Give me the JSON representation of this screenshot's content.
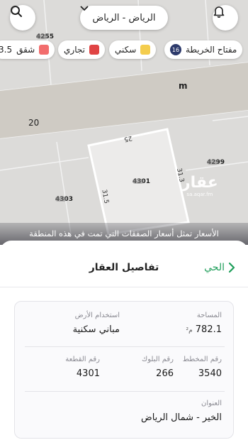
{
  "header": {
    "city": "الرياض - الرياض"
  },
  "legend": {
    "key_label": "مفتاح الخريطة",
    "key_count": "16",
    "items": [
      {
        "label": "سكني",
        "color": "#f4cd4e"
      },
      {
        "label": "تجاري",
        "color": "#e04444"
      },
      {
        "label": "شقق",
        "color": "#f26d6d",
        "count": "3.5"
      }
    ]
  },
  "map": {
    "parcels": {
      "p4255": "4255",
      "p4299": "4299",
      "p4301": "4301",
      "p4303": "4303"
    },
    "dims": {
      "top": "25",
      "right": "31.3",
      "left": "31.5"
    },
    "roads": {
      "width": "20",
      "m": "m"
    },
    "watermark": {
      "name": "عقار",
      "domain": "sa.aqar.fm"
    },
    "note": "الأسعار تمثل أسعار الصفقات التي تمت في هذه المنطقة"
  },
  "sheet": {
    "back_label": "الحي",
    "title": "تفاصيل العقار",
    "fields": {
      "area": {
        "label": "المساحة",
        "value": "782.1",
        "unit": "م²"
      },
      "land_use": {
        "label": "استخدام الأرض",
        "value": "مباني سكنية"
      },
      "plan_no": {
        "label": "رقم المخطط",
        "value": "3540"
      },
      "block_no": {
        "label": "رقم البلوك",
        "value": "266"
      },
      "plot_no": {
        "label": "رقم القطعة",
        "value": "4301"
      },
      "address": {
        "label": "العنوان",
        "value": "الخير - شمال الرياض"
      }
    }
  }
}
